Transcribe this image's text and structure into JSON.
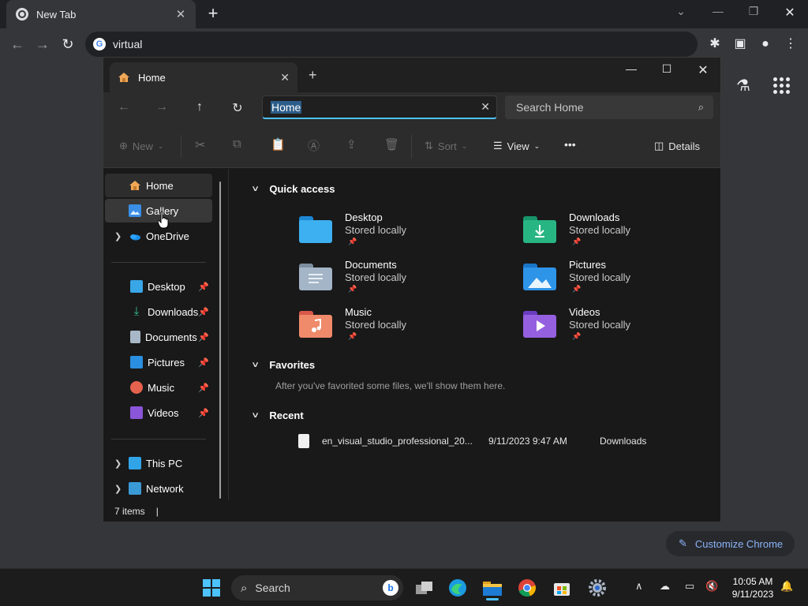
{
  "chrome": {
    "tab_title": "New Tab",
    "tab_close": "✕",
    "new_tab": "+",
    "omnibox_text": "virtual",
    "customize_label": "Customize Chrome"
  },
  "explorer": {
    "tab_title": "Home",
    "tab_close": "✕",
    "new_tab": "+",
    "address": "Home",
    "search_placeholder": "Search Home",
    "commands": {
      "new": "New",
      "sort": "Sort",
      "view": "View",
      "more": "•••",
      "details": "Details"
    },
    "nav": {
      "home": "Home",
      "gallery": "Gallery",
      "onedrive": "OneDrive",
      "desktop": "Desktop",
      "downloads": "Downloads",
      "documents": "Documents",
      "pictures": "Pictures",
      "music": "Music",
      "videos": "Videos",
      "this_pc": "This PC",
      "network": "Network"
    },
    "sections": {
      "quick_access": "Quick access",
      "favorites": "Favorites",
      "recent": "Recent"
    },
    "quick_access": [
      {
        "name": "Desktop",
        "sub": "Stored locally"
      },
      {
        "name": "Downloads",
        "sub": "Stored locally"
      },
      {
        "name": "Documents",
        "sub": "Stored locally"
      },
      {
        "name": "Pictures",
        "sub": "Stored locally"
      },
      {
        "name": "Music",
        "sub": "Stored locally"
      },
      {
        "name": "Videos",
        "sub": "Stored locally"
      }
    ],
    "favorites_empty": "After you've favorited some files, we'll show them here.",
    "recent": [
      {
        "name": "en_visual_studio_professional_20...",
        "date": "9/11/2023 9:47 AM",
        "location": "Downloads"
      }
    ],
    "status": "7 items",
    "status_caret": "|"
  },
  "taskbar": {
    "search_label": "Search",
    "time": "10:05 AM",
    "date": "9/11/2023"
  },
  "colors": {
    "accent": "#4cc2ff",
    "chrome_link": "#8ab4f8"
  }
}
